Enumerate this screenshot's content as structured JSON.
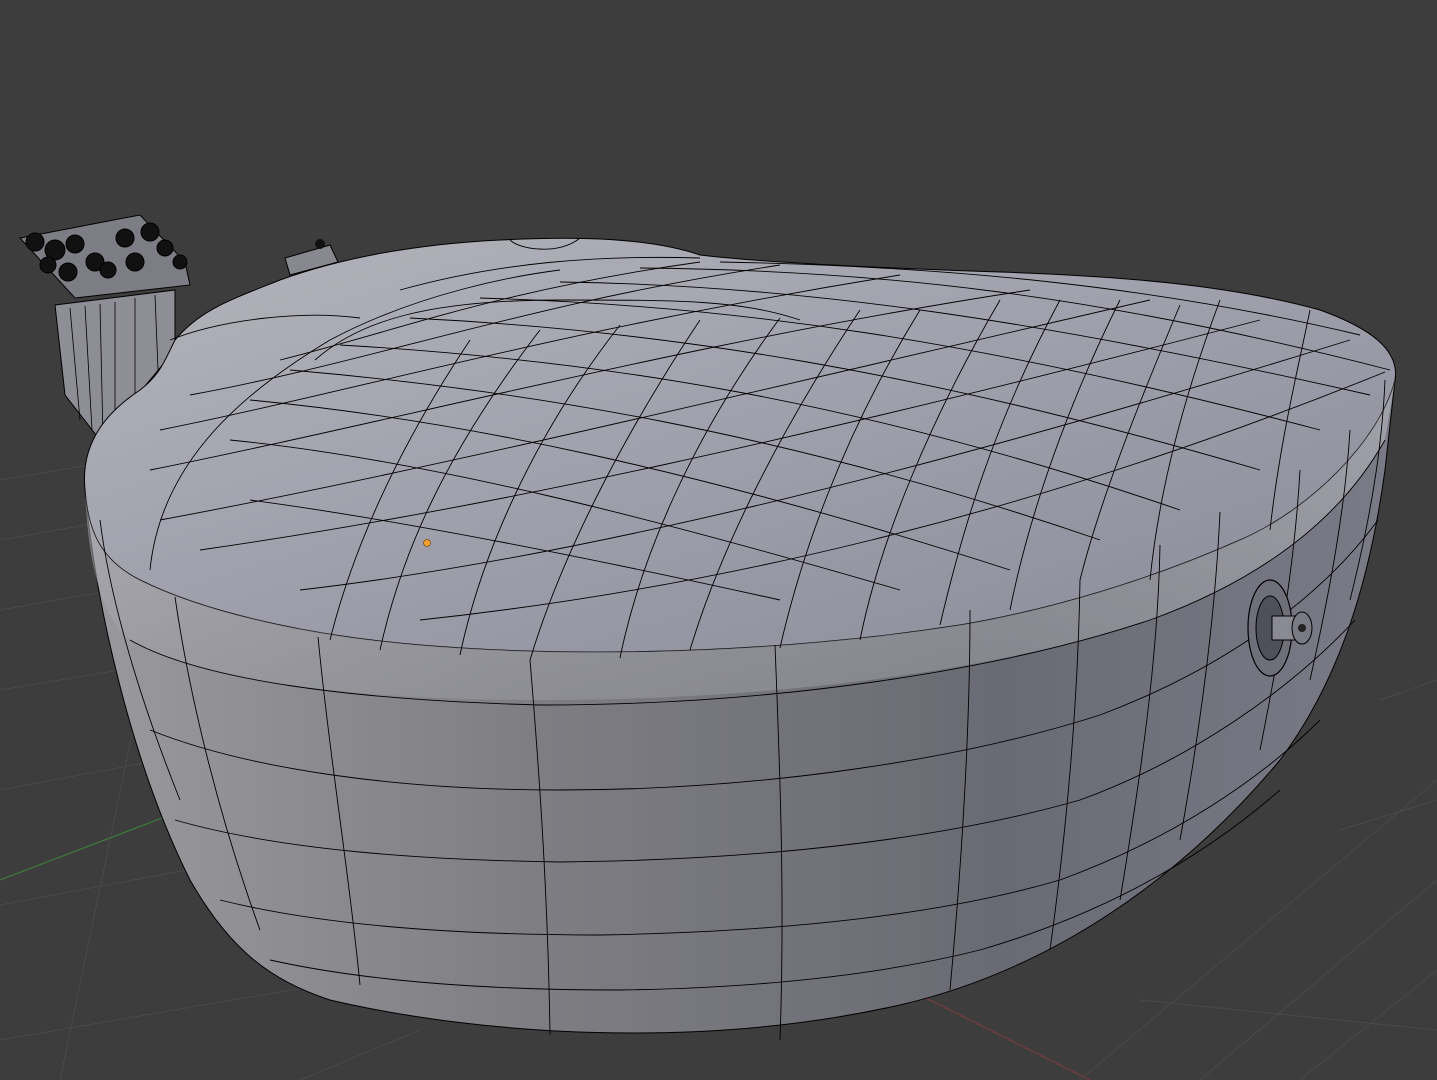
{
  "viewport": {
    "background": "#3d3d3d",
    "grid_color": "#4a4a4a",
    "x_axis_color": "#7a3a3a",
    "y_axis_color": "#3f7a3f",
    "mesh_fill": "#a3a3ad",
    "mesh_side_fill": "#8f8f9a",
    "wire_color": "#000000",
    "origin_color": "#f0a030",
    "objects": [
      {
        "name": "guitar-body-mesh"
      },
      {
        "name": "guitar-headstock-tuners"
      },
      {
        "name": "output-jack-socket"
      },
      {
        "name": "object-origin-point"
      }
    ]
  }
}
